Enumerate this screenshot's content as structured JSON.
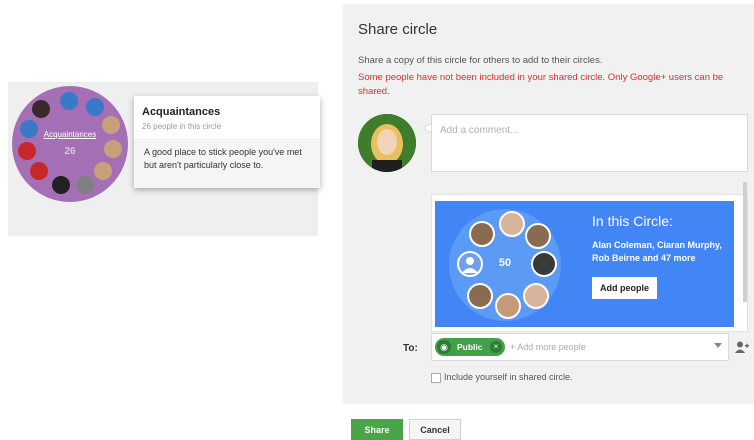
{
  "circle_card": {
    "circle_label": "Acquaintances",
    "count": "26",
    "popover_title": "Acquaintances",
    "popover_subtitle": "26 people in this circle",
    "popover_description": "A good place to stick people you've met but aren't particularly close to."
  },
  "dialog": {
    "title": "Share circle",
    "description": "Share a copy of this circle for others to add to their circles.",
    "warning": "Some people have not been included in your shared circle. Only Google+ users can be shared.",
    "comment_placeholder": "Add a comment...",
    "banner": {
      "title": "In this Circle:",
      "names": "Alan Coleman, Ciaran Murphy, Rob Beirne and 47 more",
      "count": "50",
      "add_people_label": "Add people"
    },
    "to_label": "To:",
    "chip_label": "Public",
    "add_more_placeholder": "+ Add more people",
    "include_label": "Include yourself in shared circle.",
    "share_label": "Share",
    "cancel_label": "Cancel"
  },
  "colors": {
    "accent_blue": "#4285f4",
    "share_green": "#4aa548",
    "warning_red": "#d23333",
    "circle_purple": "#a56fb5"
  }
}
